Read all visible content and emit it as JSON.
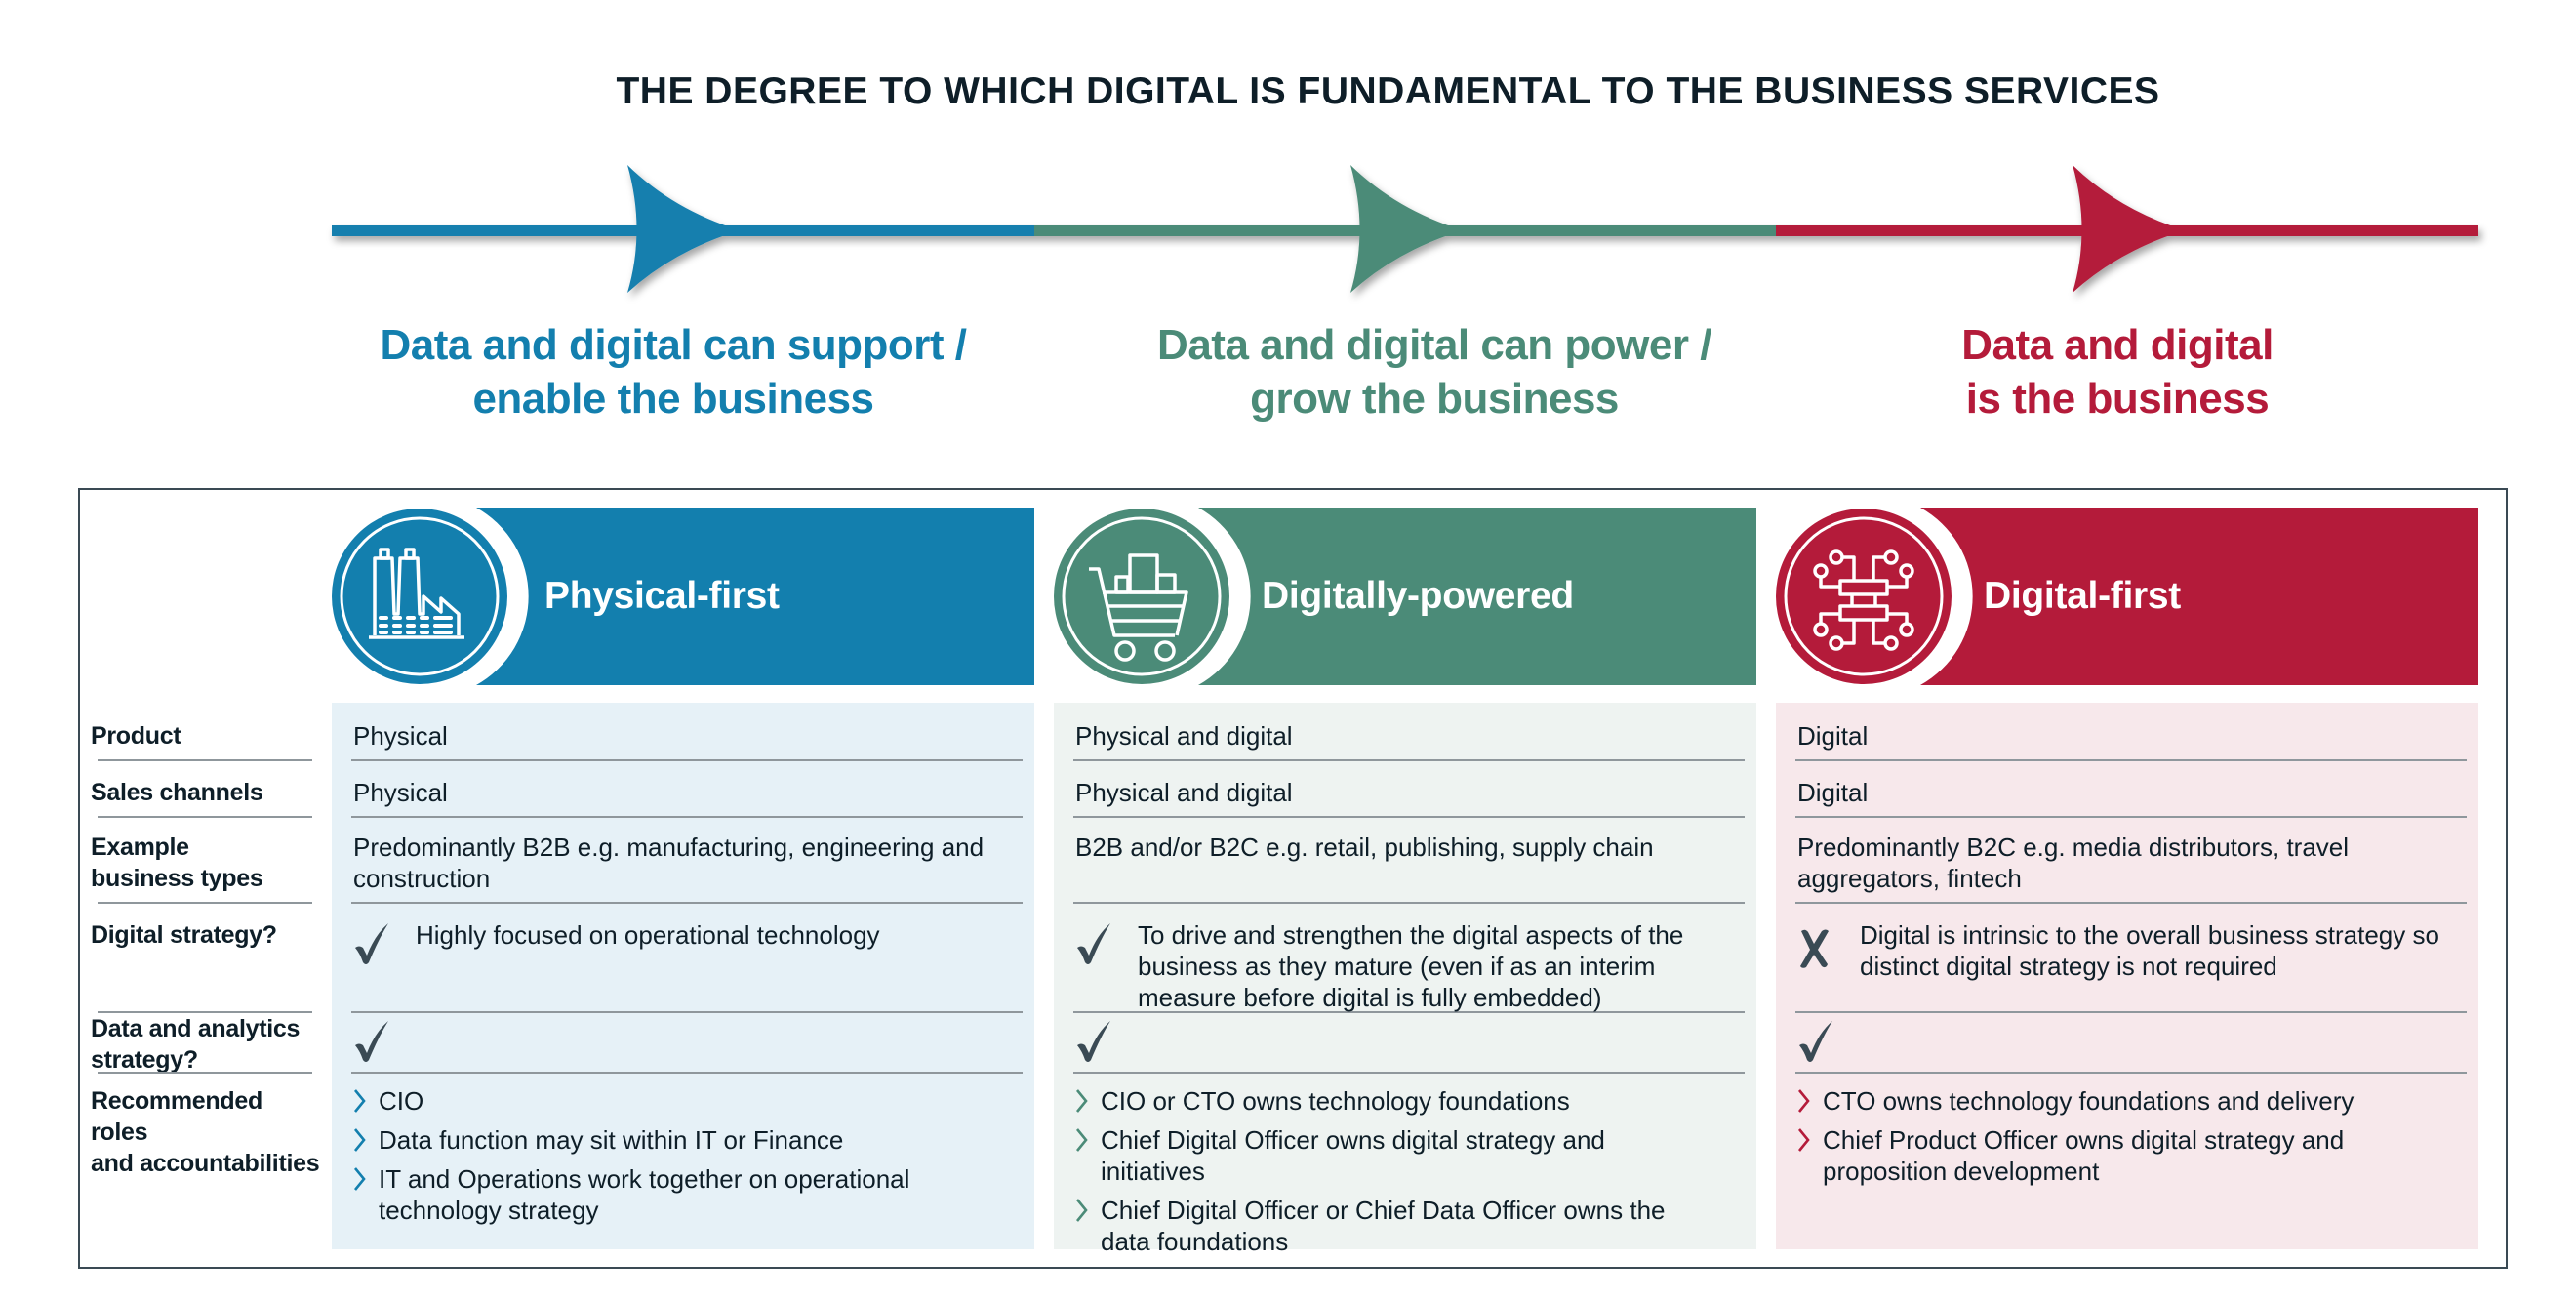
{
  "title": "THE DEGREE TO WHICH DIGITAL IS FUNDAMENTAL TO THE BUSINESS SERVICES",
  "colors": {
    "blue": "#137fae",
    "green": "#4b8b78",
    "red": "#b41b3a",
    "text": "#0e1e28",
    "mark": "#3a4a54"
  },
  "stages": [
    {
      "line1": "Data and digital can support /",
      "line2": "enable the business",
      "color": "#137fae"
    },
    {
      "line1": "Data and digital can power /",
      "line2": "grow the business",
      "color": "#4b8b78"
    },
    {
      "line1": "Data and digital",
      "line2": "is the business",
      "color": "#b41b3a"
    }
  ],
  "row_labels": [
    "Product",
    "Sales channels",
    "Example\nbusiness types",
    "Digital strategy?",
    "Data and analytics\nstrategy?",
    "Recommended roles\nand accountabilities"
  ],
  "columns": [
    {
      "title": "Physical-first",
      "icon": "factory-icon",
      "color": "#137fae",
      "bg": "#e6f1f7",
      "product": "Physical",
      "sales_channels": "Physical",
      "business_types": "Predominantly B2B e.g. manufacturing, engineering and construction",
      "digital_strategy": {
        "mark": "check",
        "text": "Highly focused on operational technology"
      },
      "data_analytics_strategy": {
        "mark": "check"
      },
      "roles": [
        "CIO",
        "Data function may sit within IT or Finance",
        "IT and Operations work together on operational technology strategy"
      ]
    },
    {
      "title": "Digitally-powered",
      "icon": "shopping-cart-icon",
      "color": "#4b8b78",
      "bg": "#eef3f1",
      "product": "Physical and digital",
      "sales_channels": "Physical and digital",
      "business_types": "B2B and/or B2C e.g. retail, publishing, supply chain",
      "digital_strategy": {
        "mark": "check",
        "text": "To drive and strengthen the digital aspects of the business as they mature (even if as an interim measure before digital is fully embedded)"
      },
      "data_analytics_strategy": {
        "mark": "check"
      },
      "roles": [
        "CIO or CTO owns technology foundations",
        "Chief Digital Officer owns digital strategy and initiatives",
        "Chief Digital Officer or Chief Data Officer owns the data foundations"
      ]
    },
    {
      "title": "Digital-first",
      "icon": "circuit-chip-icon",
      "color": "#b41b3a",
      "bg": "#f7e8eb",
      "product": "Digital",
      "sales_channels": "Digital",
      "business_types": "Predominantly B2C e.g. media distributors, travel aggregators, fintech",
      "digital_strategy": {
        "mark": "cross",
        "text": "Digital is intrinsic to the overall business strategy so distinct digital strategy is not required"
      },
      "data_analytics_strategy": {
        "mark": "check"
      },
      "roles": [
        "CTO owns technology foundations and delivery",
        "Chief Product Officer owns digital strategy and proposition development"
      ]
    }
  ]
}
